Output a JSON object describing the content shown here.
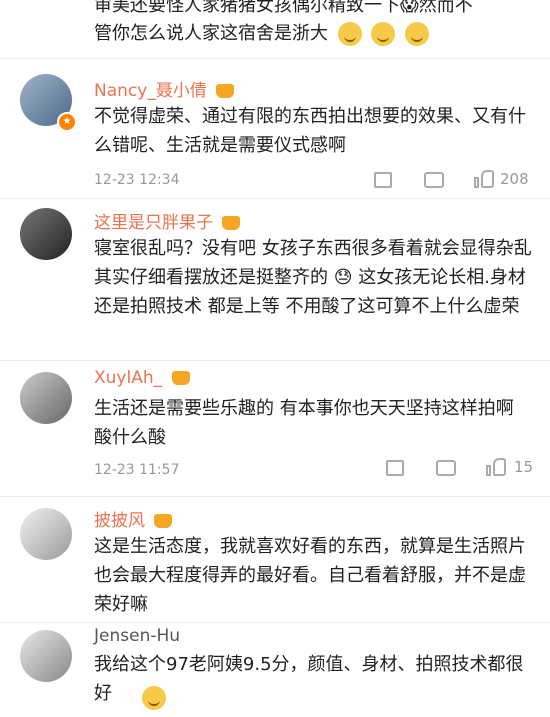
{
  "top_fragment": {
    "line1": "审美还要怪人家猪猪女孩偶尔精致一下😱然而不",
    "line2": "管你怎么说人家这宿舍是浙大"
  },
  "comments": [
    {
      "username": "Nancy_聂小倩",
      "text": "不觉得虚荣、通过有限的东西拍出想要的效果、又有什么错呢、生活就是需要仪式感啊",
      "time": "12-23 12:34",
      "likes": "208"
    },
    {
      "username": "这里是只胖果子",
      "text": "寝室很乱吗？没有吧 女孩子东西很多看着就会显得杂乱 其实仔细看摆放还是挺整齐的 😓 这女孩无论长相.身材还是拍照技术 都是上等 不用酸了这可算不上什么虚荣"
    },
    {
      "username": "XuylAh_",
      "text": "生活还是需要些乐趣的 有本事你也天天坚持这样拍啊 酸什么酸",
      "time": "12-23 11:57",
      "likes": "15"
    },
    {
      "username": "披披风",
      "text": "这是生活态度，我就喜欢好看的东西，就算是生活照片也会最大程度得弄的最好看。自己看着舒服，并不是虚荣好嘛"
    },
    {
      "username": "Jensen-Hu",
      "text": "我给这个97老阿姨9.5分，颜值、身材、拍照技术都很好"
    }
  ],
  "icons": {
    "repost": "repost-icon",
    "comment": "comment-icon",
    "like": "thumbs-up-icon",
    "crown": "crown-icon",
    "vip": "vip-badge-icon"
  },
  "colors": {
    "username": "#eb7350",
    "meta": "#999999",
    "divider": "#eeeeee"
  }
}
